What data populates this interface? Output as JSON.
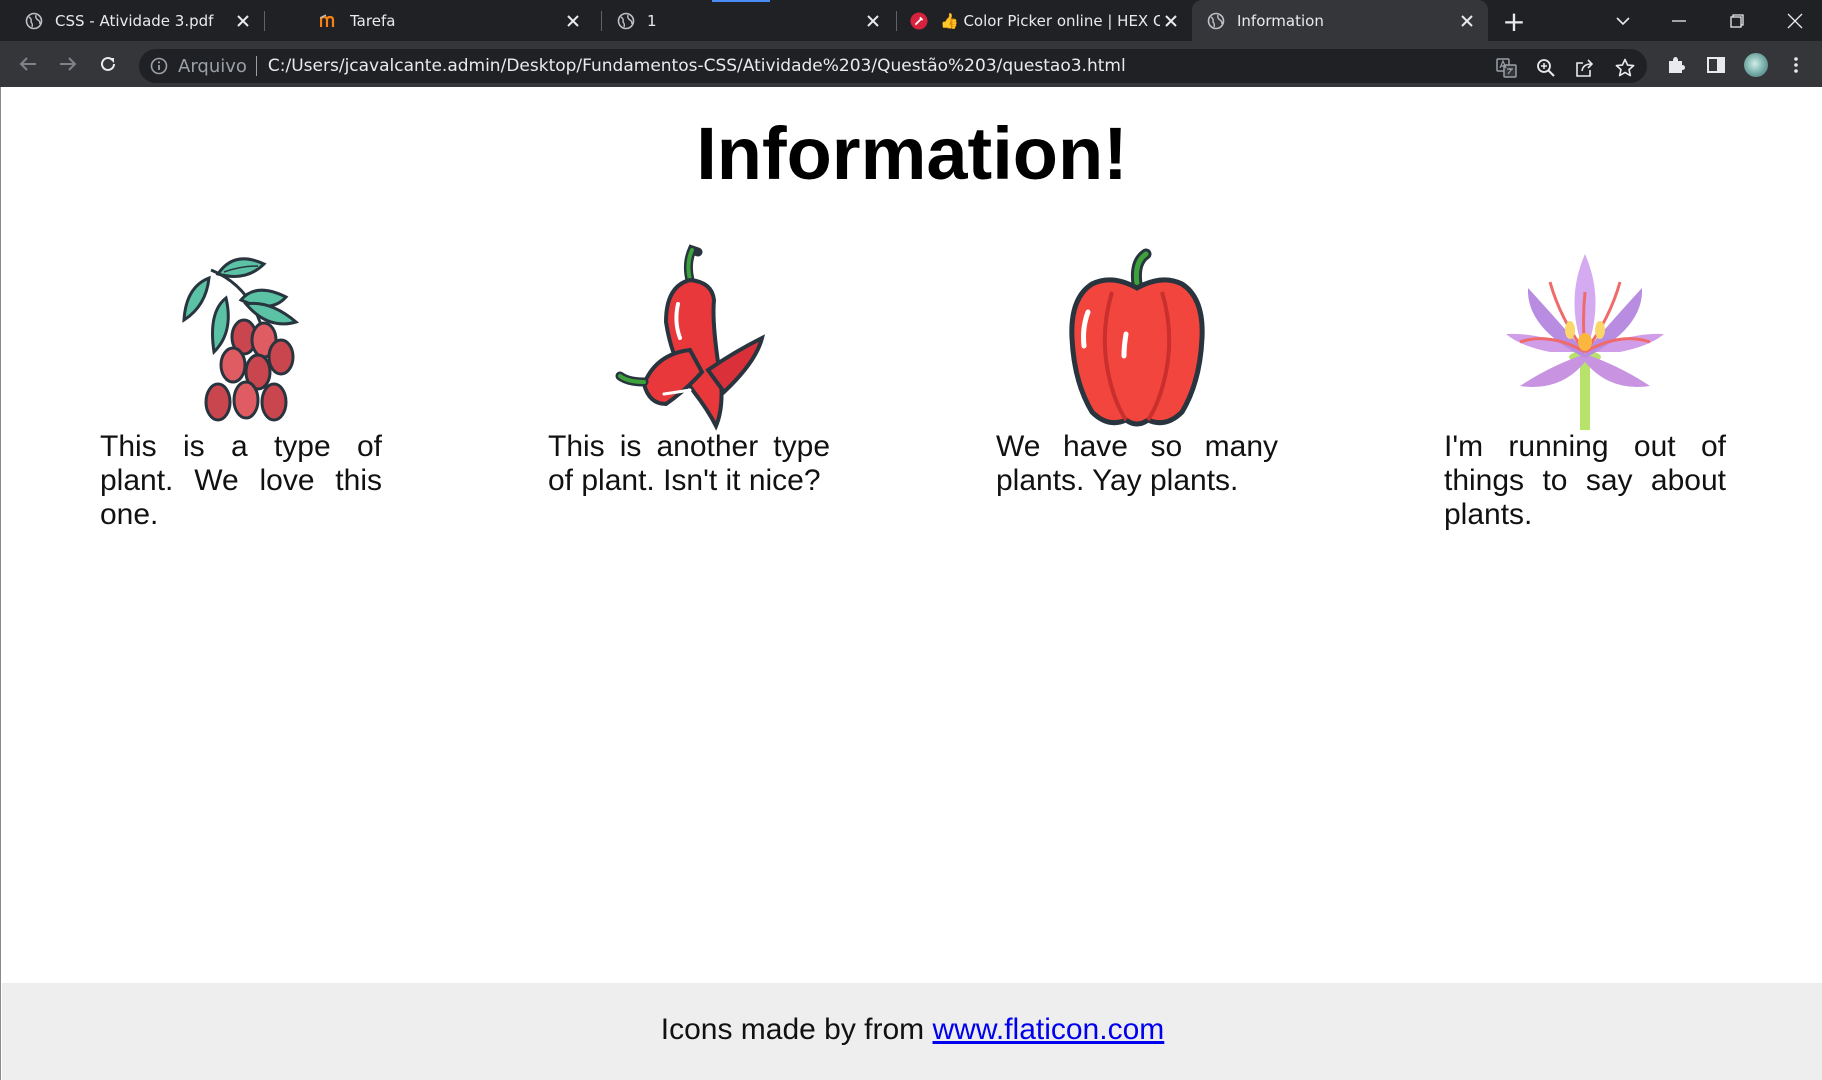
{
  "browser": {
    "tabs": [
      {
        "title": "CSS - Atividade 3.pdf",
        "favicon": "globe-icon",
        "active": false
      },
      {
        "title": "Tarefa",
        "favicon": "moodle-icon",
        "active": false
      },
      {
        "title": "1",
        "favicon": "globe-icon",
        "active": false
      },
      {
        "title": "👍 Color Picker online | HEX Color",
        "favicon": "color-picker-icon",
        "active": false
      },
      {
        "title": "Information",
        "favicon": "globe-icon",
        "active": true
      }
    ],
    "new_tab_symbol": "+",
    "address_bar": {
      "chip": "Arquivo",
      "url": "C:/Users/jcavalcante.admin/Desktop/Fundamentos-CSS/Atividade%203/Questão%203/questao3.html"
    }
  },
  "page": {
    "title": "Information!",
    "cards": [
      {
        "icon": "goji-berries-icon",
        "text": "This is a type of plant. We love this one."
      },
      {
        "icon": "chili-pepper-icon",
        "text": "This is another type of plant. Isn't it nice?"
      },
      {
        "icon": "bell-pepper-icon",
        "text": "We have so many plants. Yay plants."
      },
      {
        "icon": "saffron-flower-icon",
        "text": "I'm running out of things to say about plants."
      }
    ],
    "footer": {
      "prefix": "Icons made by from ",
      "link_text": "www.flaticon.com"
    }
  },
  "colors": {
    "tabstrip_bg": "#202124",
    "toolbar_bg": "#35363a",
    "footer_bg": "#eeeeee",
    "link": "#0000ee"
  }
}
